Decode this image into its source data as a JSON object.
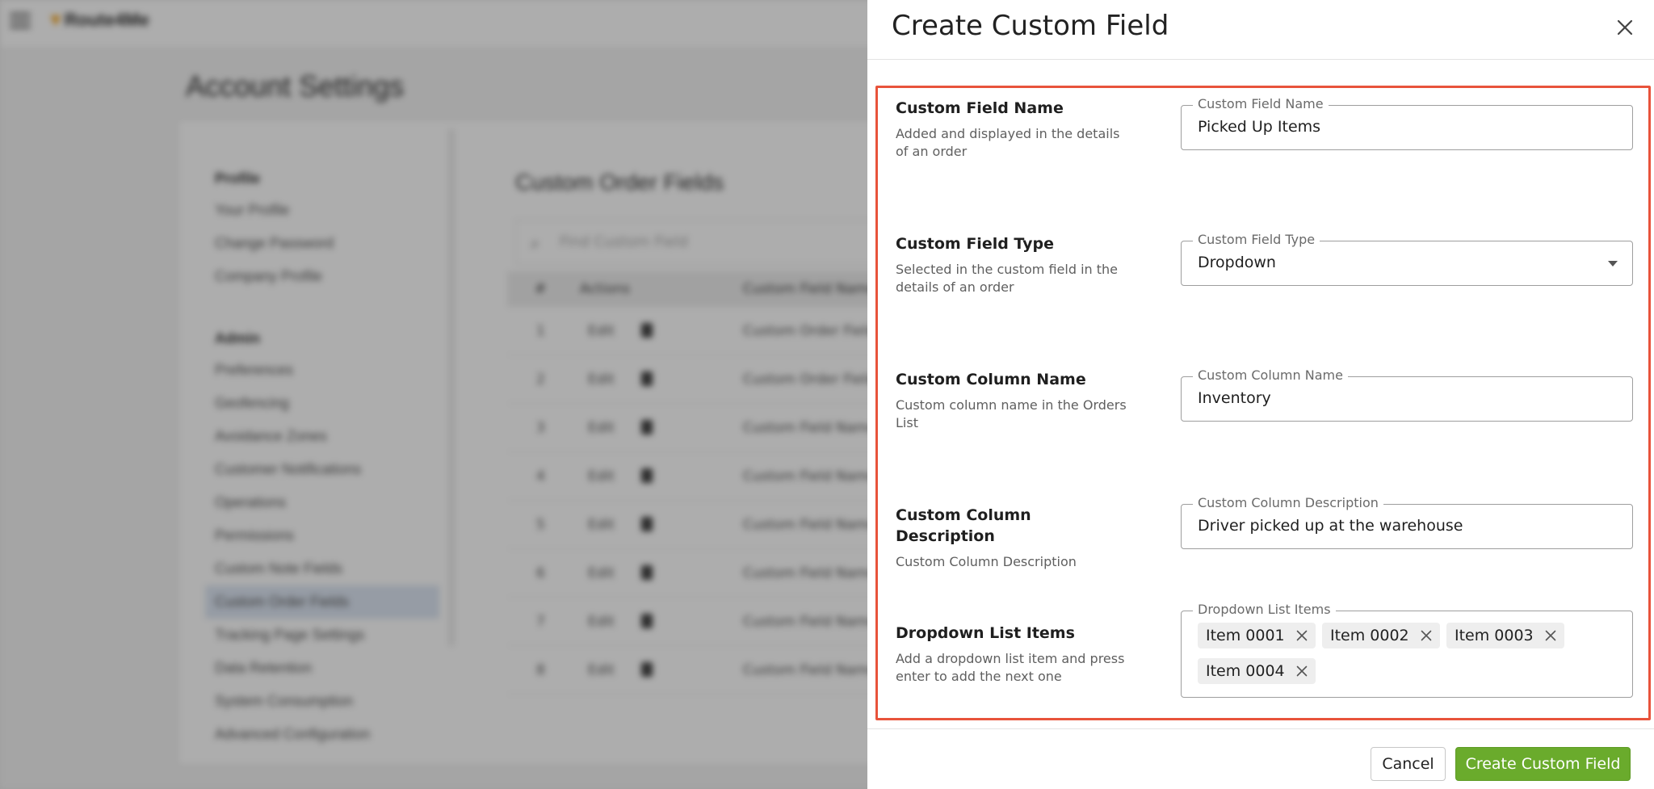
{
  "background": {
    "logo_text": "Route4Me",
    "page_title": "Account Settings",
    "nav": {
      "profile_group": "Profile",
      "profile_items": [
        "Your Profile",
        "Change Password",
        "Company Profile"
      ],
      "admin_group": "Admin",
      "admin_items": [
        "Preferences",
        "Geofencing",
        "Avoidance Zones",
        "Customer Notifications",
        "Operations",
        "Permissions",
        "Custom Note Fields",
        "Custom Order Fields",
        "Tracking Page Settings",
        "Data Retention",
        "System Consumption",
        "Advanced Configuration"
      ],
      "active_item": "Custom Order Fields"
    },
    "section_title": "Custom Order Fields",
    "search_placeholder": "Find Custom Field",
    "table_headers": [
      "#",
      "Actions",
      "Custom Field Name"
    ],
    "rows": [
      {
        "num": "1",
        "edit": "Edit",
        "name": "Custom Order Field"
      },
      {
        "num": "2",
        "edit": "Edit",
        "name": "Custom Order Field"
      },
      {
        "num": "3",
        "edit": "Edit",
        "name": "Custom Field Name"
      },
      {
        "num": "4",
        "edit": "Edit",
        "name": "Custom Field Name"
      },
      {
        "num": "5",
        "edit": "Edit",
        "name": "Custom Field Name"
      },
      {
        "num": "6",
        "edit": "Edit",
        "name": "Custom Field Name"
      },
      {
        "num": "7",
        "edit": "Edit",
        "name": "Custom Field Name"
      },
      {
        "num": "8",
        "edit": "Edit",
        "name": "Custom Field Name"
      }
    ]
  },
  "drawer": {
    "title": "Create Custom Field",
    "fields": {
      "name": {
        "label": "Custom Field Name",
        "description": "Added and displayed in the details of an order",
        "legend": "Custom Field Name",
        "value": "Picked Up Items"
      },
      "type": {
        "label": "Custom Field Type",
        "description": "Selected in the custom field in the details of an order",
        "legend": "Custom Field Type",
        "value": "Dropdown"
      },
      "column_name": {
        "label": "Custom Column Name",
        "description": "Custom column name in the Orders List",
        "legend": "Custom Column Name",
        "value": "Inventory"
      },
      "column_description": {
        "label": "Custom Column Description",
        "description": "Custom Column Description",
        "legend": "Custom Column Description",
        "value": "Driver picked up at the warehouse"
      },
      "dropdown_items": {
        "label": "Dropdown List Items",
        "description": "Add a dropdown list item and press enter to add the next one",
        "legend": "Dropdown List Items",
        "items": [
          "Item 0001",
          "Item 0002",
          "Item 0003",
          "Item 0004"
        ]
      }
    },
    "footer": {
      "cancel_label": "Cancel",
      "create_label": "Create Custom Field"
    },
    "colors": {
      "highlight_border": "#e8533b",
      "primary_button": "#6aab2c"
    }
  }
}
